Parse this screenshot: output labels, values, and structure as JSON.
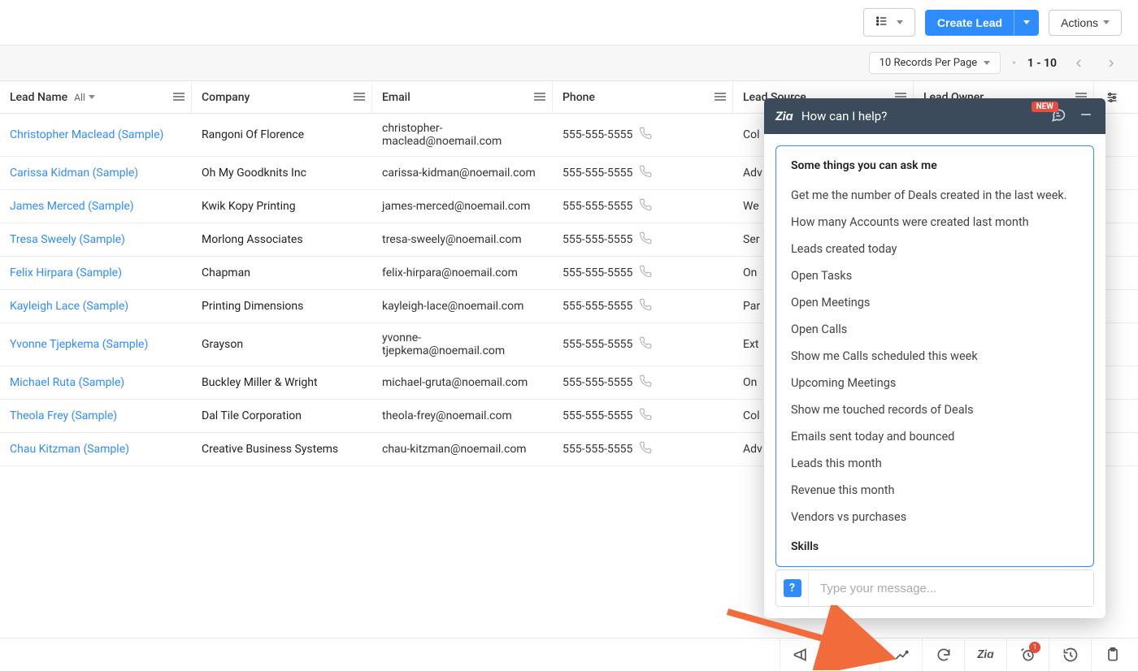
{
  "toolbar": {
    "createLead": "Create Lead",
    "actions": "Actions"
  },
  "pager": {
    "perPage": "10 Records Per Page",
    "range": "1 - 10"
  },
  "columns": {
    "leadName": "Lead Name",
    "leadNameFilter": "All",
    "company": "Company",
    "email": "Email",
    "phone": "Phone",
    "leadSource": "Lead Source",
    "leadOwner": "Lead Owner"
  },
  "rows": [
    {
      "leadName": "Christopher Maclead (Sample)",
      "company": "Rangoni Of Florence",
      "email": "christopher-maclead@noemail.com",
      "phone": "555-555-5555",
      "leadSource": "Col"
    },
    {
      "leadName": "Carissa Kidman (Sample)",
      "company": "Oh My Goodknits Inc",
      "email": "carissa-kidman@noemail.com",
      "phone": "555-555-5555",
      "leadSource": "Adv"
    },
    {
      "leadName": "James Merced (Sample)",
      "company": "Kwik Kopy Printing",
      "email": "james-merced@noemail.com",
      "phone": "555-555-5555",
      "leadSource": "We"
    },
    {
      "leadName": "Tresa Sweely (Sample)",
      "company": "Morlong Associates",
      "email": "tresa-sweely@noemail.com",
      "phone": "555-555-5555",
      "leadSource": "Ser"
    },
    {
      "leadName": "Felix Hirpara (Sample)",
      "company": "Chapman",
      "email": "felix-hirpara@noemail.com",
      "phone": "555-555-5555",
      "leadSource": "On"
    },
    {
      "leadName": "Kayleigh Lace (Sample)",
      "company": "Printing Dimensions",
      "email": "kayleigh-lace@noemail.com",
      "phone": "555-555-5555",
      "leadSource": "Par"
    },
    {
      "leadName": "Yvonne Tjepkema (Sample)",
      "company": "Grayson",
      "email": "yvonne-tjepkema@noemail.com",
      "phone": "555-555-5555",
      "leadSource": "Ext"
    },
    {
      "leadName": "Michael Ruta (Sample)",
      "company": "Buckley Miller & Wright",
      "email": "michael-gruta@noemail.com",
      "phone": "555-555-5555",
      "leadSource": "On"
    },
    {
      "leadName": "Theola Frey (Sample)",
      "company": "Dal Tile Corporation",
      "email": "theola-frey@noemail.com",
      "phone": "555-555-5555",
      "leadSource": "Col"
    },
    {
      "leadName": "Chau Kitzman (Sample)",
      "company": "Creative Business Systems",
      "email": "chau-kitzman@noemail.com",
      "phone": "555-555-5555",
      "leadSource": "Adv"
    }
  ],
  "zia": {
    "headerTitle": "How can I help?",
    "newBadge": "NEW",
    "cardTitle": "Some things you can ask me",
    "suggestions": [
      "Get me the number of Deals created in the last week.",
      "How many Accounts were created last month",
      "Leads created today",
      "Open Tasks",
      "Open Meetings",
      "Open Calls",
      "Show me Calls scheduled this week",
      "Upcoming Meetings",
      "Show me touched records of Deals",
      "Emails sent today and bounced",
      "Leads this month",
      "Revenue this month",
      "Vendors vs purchases"
    ],
    "skillsLabel": "Skills",
    "inputPlaceholder": "Type your message...",
    "helpSymbol": "?"
  },
  "bottomBar": {
    "askZia": "Ask Zia",
    "notificationCount": "1"
  }
}
